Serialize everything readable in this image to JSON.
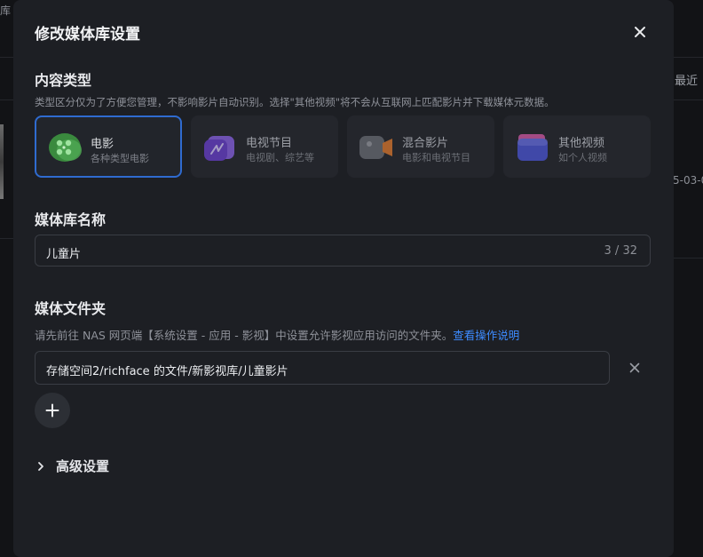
{
  "background": {
    "left_fragment": "库",
    "right_header": "最近",
    "right_date": "5-03-0"
  },
  "dialog": {
    "title": "修改媒体库设置",
    "close_icon": "close-icon"
  },
  "content_type": {
    "title": "内容类型",
    "description": "类型区分仅为了方便您管理，不影响影片自动识别。选择\"其他视频\"将不会从互联网上匹配影片并下载媒体元数据。",
    "selected": "movie",
    "options": [
      {
        "id": "movie",
        "label": "电影",
        "sub": "各种类型电影",
        "icon": "film-reel-icon",
        "color": "#3a8a3e"
      },
      {
        "id": "tv",
        "label": "电视节目",
        "sub": "电视剧、综艺等",
        "icon": "tv-icon",
        "color": "#7b4fd6"
      },
      {
        "id": "mixed",
        "label": "混合影片",
        "sub": "电影和电视节目",
        "icon": "video-camera-icon",
        "color": "#e07a2e"
      },
      {
        "id": "other",
        "label": "其他视频",
        "sub": "如个人视频",
        "icon": "folder-icon",
        "color": "#5a5fd8"
      }
    ]
  },
  "library_name": {
    "title": "媒体库名称",
    "value": "儿童片",
    "counter": "3 / 32"
  },
  "media_folder": {
    "title": "媒体文件夹",
    "description": "请先前往 NAS 网页端【系统设置 - 应用 - 影视】中设置允许影视应用访问的文件夹。",
    "help_link": "查看操作说明",
    "folders": [
      "存储空间2/richface 的文件/新影视库/儿童影片"
    ]
  },
  "advanced": {
    "label": "高级设置"
  },
  "colors": {
    "accent": "#2f6bd0",
    "link": "#3d8bff",
    "dialog_bg": "#1d1f24"
  }
}
